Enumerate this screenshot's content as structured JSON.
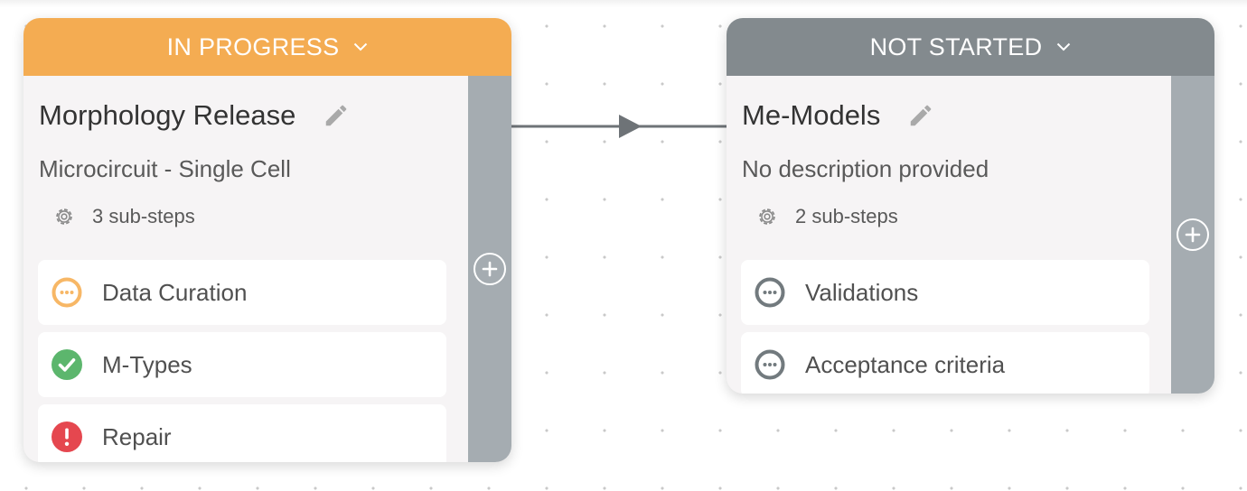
{
  "canvas": {
    "background": "#ffffff",
    "dot_color": "#c9c9c9"
  },
  "connector": {
    "color": "#6e7377"
  },
  "steps": [
    {
      "status": "IN PROGRESS",
      "status_color": "#f4ac52",
      "title": "Morphology Release",
      "description": "Microcircuit - Single Cell",
      "substeps_label": "3 sub-steps",
      "substeps": [
        {
          "label": "Data Curation",
          "state": "in-progress",
          "icon": "ellipsis-icon",
          "icon_color": "#f7b766"
        },
        {
          "label": "M-Types",
          "state": "done",
          "icon": "check-icon",
          "icon_color": "#5cb66d"
        },
        {
          "label": "Repair",
          "state": "blocked",
          "icon": "exclamation-icon",
          "icon_color": "#e5474f"
        }
      ]
    },
    {
      "status": "NOT STARTED",
      "status_color": "#838a8e",
      "title": "Me-Models",
      "description": "No description provided",
      "substeps_label": "2 sub-steps",
      "substeps": [
        {
          "label": "Validations",
          "state": "not-started",
          "icon": "ellipsis-icon",
          "icon_color": "#727a7e"
        },
        {
          "label": "Acceptance criteria",
          "state": "not-started",
          "icon": "ellipsis-icon",
          "icon_color": "#727a7e"
        }
      ]
    }
  ]
}
